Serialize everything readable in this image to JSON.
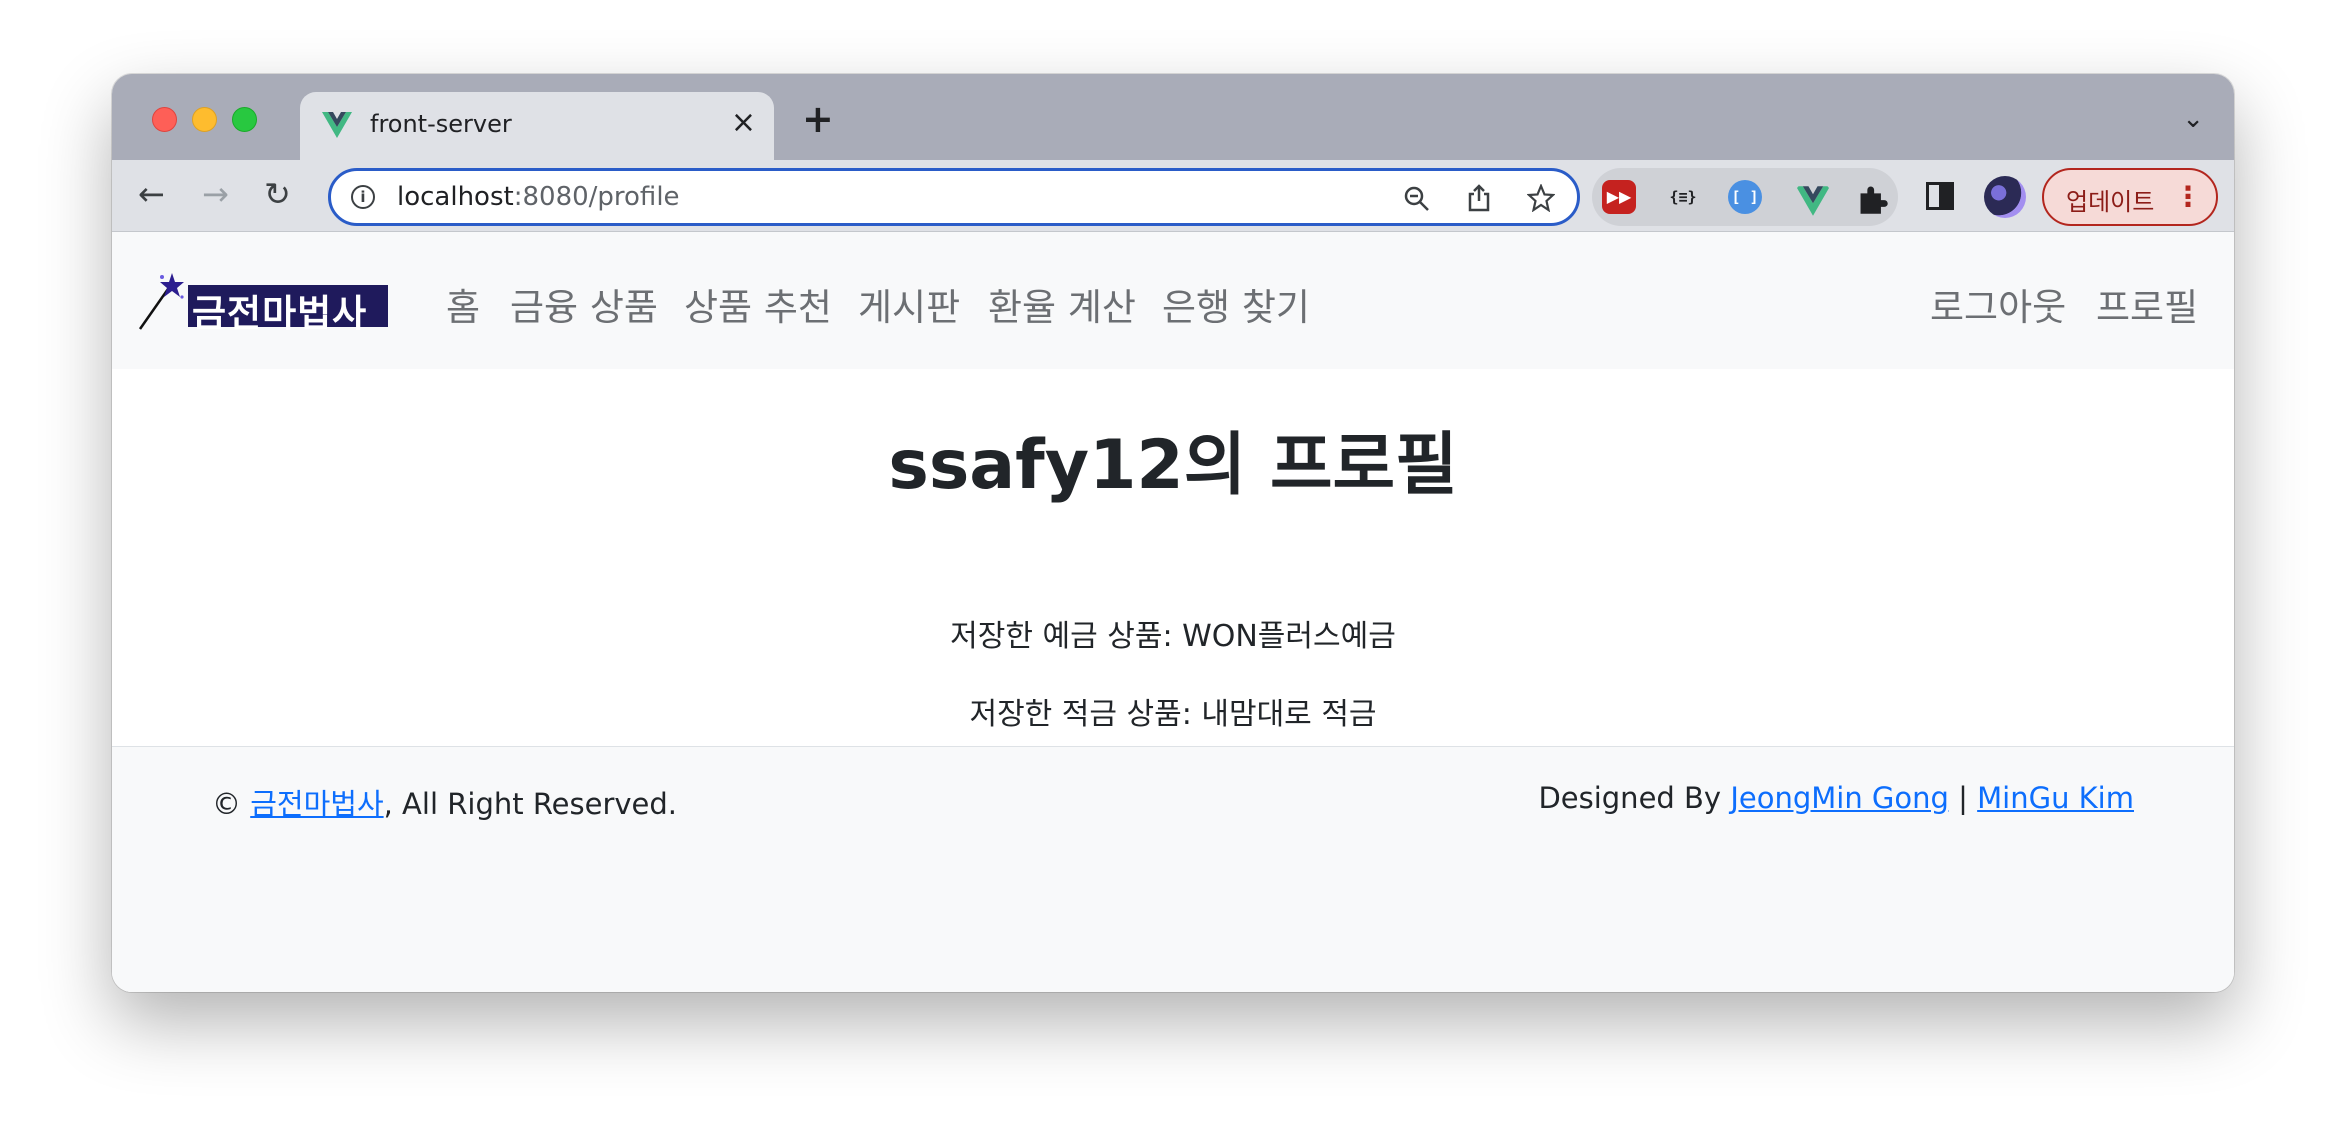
{
  "browser": {
    "tab": {
      "title": "front-server",
      "close": "×"
    },
    "new_tab": "+",
    "tab_dropdown": "⌄",
    "nav": {
      "back": "←",
      "forward": "→",
      "reload": "↻"
    },
    "url": {
      "host": "localhost",
      "path": ":8080/profile"
    },
    "omnibox_icons": [
      "zoom-out-icon",
      "share-icon",
      "star-icon"
    ],
    "extensions": {
      "json_viewer": "{≡}",
      "bracket": "[ ]",
      "puzzle": "✱"
    },
    "update_button": {
      "label": "업데이트",
      "menu": "⋮"
    }
  },
  "navbar": {
    "logo_text": "금전마법사",
    "links": [
      "홈",
      "금융 상품",
      "상품 추천",
      "게시판",
      "환율 계산",
      "은행 찾기"
    ],
    "right_links": [
      "로그아웃",
      "프로필"
    ]
  },
  "profile": {
    "title": "ssafy12의 프로필",
    "saved_deposit": "저장한 예금 상품: WON플러스예금",
    "saved_savings": "저장한 적금 상품: 내맘대로 적금"
  },
  "footer": {
    "copyright_symbol": "©",
    "brand_link": "금전마법사",
    "rights": ", All Right Reserved.",
    "designed_by": "Designed By",
    "designer1": "JeongMin Gong",
    "separator": "|",
    "designer2": "MinGu Kim"
  },
  "colors": {
    "tab_strip": "#a9acb8",
    "toolbar": "#dfe1e6",
    "omnibox_border": "#2a5cc8",
    "navbar_bg": "#f8f9fa",
    "nav_link": "#6c6f73",
    "link": "#0d6efd",
    "logo": "#1f1a5c"
  }
}
